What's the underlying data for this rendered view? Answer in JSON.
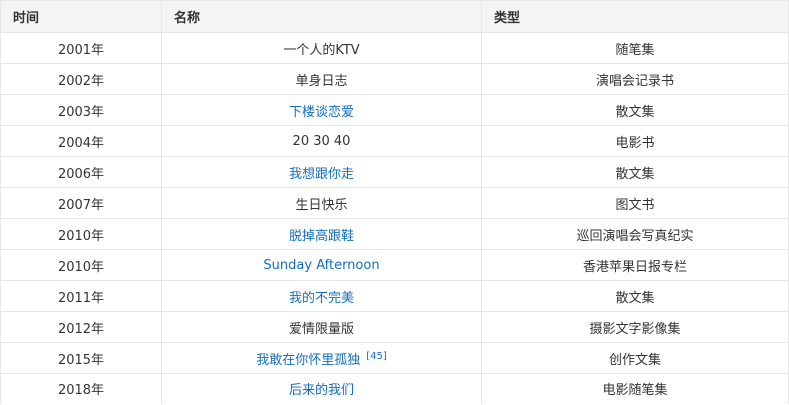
{
  "table": {
    "headers": [
      "时间",
      "名称",
      "类型"
    ],
    "rows": [
      {
        "year": "2001年",
        "title": "一个人的KTV",
        "type": "随笔集",
        "link": false,
        "ref": ""
      },
      {
        "year": "2002年",
        "title": "单身日志",
        "type": "演唱会记录书",
        "link": false,
        "ref": ""
      },
      {
        "year": "2003年",
        "title": "下楼谈恋爱",
        "type": "散文集",
        "link": true,
        "ref": ""
      },
      {
        "year": "2004年",
        "title": "20 30 40",
        "type": "电影书",
        "link": false,
        "ref": ""
      },
      {
        "year": "2006年",
        "title": "我想跟你走",
        "type": "散文集",
        "link": true,
        "ref": ""
      },
      {
        "year": "2007年",
        "title": "生日快乐",
        "type": "图文书",
        "link": false,
        "ref": ""
      },
      {
        "year": "2010年",
        "title": "脱掉高跟鞋",
        "type": "巡回演唱会写真纪实",
        "link": true,
        "ref": ""
      },
      {
        "year": "2010年",
        "title": "Sunday Afternoon",
        "type": "香港苹果日报专栏",
        "link": true,
        "ref": ""
      },
      {
        "year": "2011年",
        "title": "我的不完美",
        "type": "散文集",
        "link": true,
        "ref": ""
      },
      {
        "year": "2012年",
        "title": "爱情限量版",
        "type": "摄影文字影像集",
        "link": false,
        "ref": ""
      },
      {
        "year": "2015年",
        "title": "我敢在你怀里孤独",
        "type": "创作文集",
        "link": true,
        "ref": "[45]"
      },
      {
        "year": "2018年",
        "title": "后来的我们",
        "type": "电影随笔集",
        "link": true,
        "ref": ""
      }
    ]
  },
  "colors": {
    "link": "#136ec2",
    "text": "#333333",
    "header_bg": "#f5f5f5",
    "border": "#e6e6e6"
  }
}
